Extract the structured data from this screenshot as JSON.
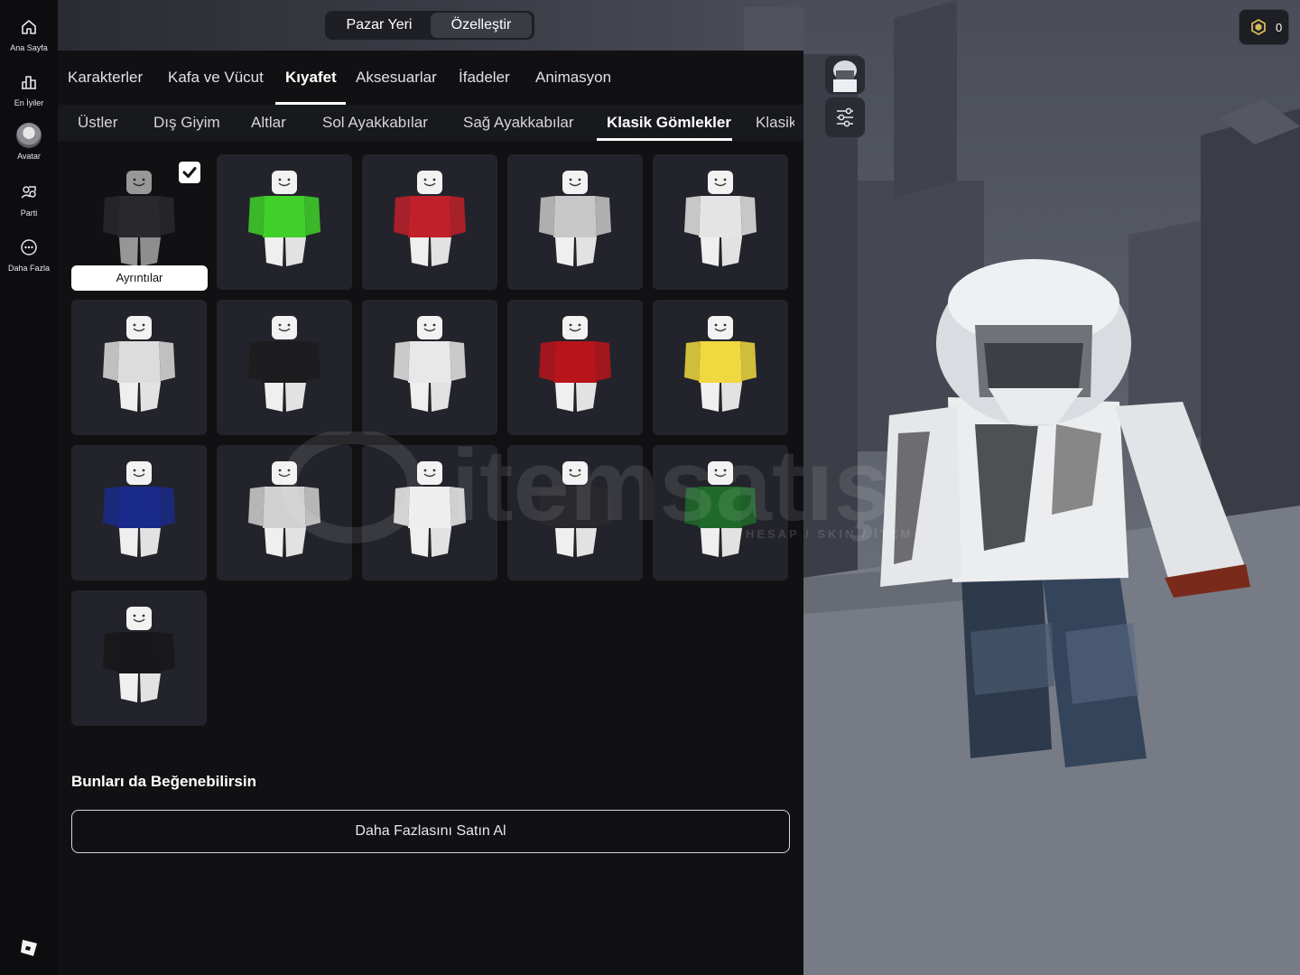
{
  "nav": {
    "items": [
      {
        "label": "Ana Sayfa",
        "icon": "home-icon"
      },
      {
        "label": "En İyiler",
        "icon": "charts-icon"
      },
      {
        "label": "Avatar",
        "icon": "avatar-icon"
      },
      {
        "label": "Parti",
        "icon": "party-icon"
      },
      {
        "label": "Daha Fazla",
        "icon": "more-icon"
      }
    ],
    "logo_icon": "roblox-logo-icon"
  },
  "mode_toggle": {
    "market": "Pazar Yeri",
    "customize": "Özelleştir",
    "selected": "Özelleştir"
  },
  "currency": {
    "amount": "0",
    "icon": "robux-icon"
  },
  "categories": [
    "Karakterler",
    "Kafa ve Vücut",
    "Kıyafet",
    "Aksesuarlar",
    "İfadeler",
    "Animasyon"
  ],
  "active_category": "Kıyafet",
  "subcategories": [
    "Üstler",
    "Dış Giyim",
    "Altlar",
    "Sol Ayakkabılar",
    "Sağ Ayakkabılar",
    "Klasik Gömlekler",
    "Klasik"
  ],
  "active_subcategory": "Klasik Gömlekler",
  "grid": {
    "details_label": "Ayrıntılar",
    "items": [
      {
        "color": "#3a3a3e",
        "selected": true
      },
      {
        "color": "#3fd12a",
        "selected": false
      },
      {
        "color": "#c0202a",
        "selected": false
      },
      {
        "color": "#c8c8c8",
        "selected": false
      },
      {
        "color": "#e4e4e4",
        "selected": false
      },
      {
        "color": "#dcdcdc",
        "selected": false
      },
      {
        "color": "#1c1c1e",
        "selected": false
      },
      {
        "color": "#e8e8e8",
        "selected": false
      },
      {
        "color": "#b8141c",
        "selected": false
      },
      {
        "color": "#f0d840",
        "selected": false
      },
      {
        "color": "#1a2a8a",
        "selected": false
      },
      {
        "color": "#d0d0d0",
        "selected": false
      },
      {
        "color": "#eeeeee",
        "selected": false
      },
      {
        "color": "#2a2a2e",
        "selected": false
      },
      {
        "color": "#1f6a2a",
        "selected": false
      },
      {
        "color": "#18181a",
        "selected": false
      }
    ]
  },
  "suggestions": {
    "title": "Bunları da Beğenebilirsin",
    "buy_more": "Daha Fazlasını Satın Al"
  },
  "watermark": {
    "text": "itemsatış",
    "subtext": "HESAP / SKIN / İTEM"
  }
}
